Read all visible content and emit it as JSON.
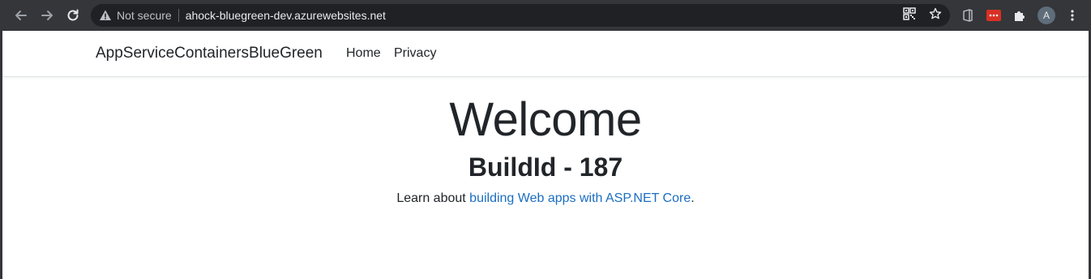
{
  "browser": {
    "address_security": "Not secure",
    "url": "ahock-bluegreen-dev.azurewebsites.net",
    "profile_initial": "A"
  },
  "navbar": {
    "brand": "AppServiceContainersBlueGreen",
    "links": [
      "Home",
      "Privacy"
    ]
  },
  "main": {
    "heading": "Welcome",
    "build_id": "BuildId - 187",
    "learn_prefix": "Learn about ",
    "learn_link": "building Web apps with ASP.NET Core",
    "learn_suffix": "."
  },
  "colors": {
    "chrome_bg": "#35363a",
    "omnibox_bg": "#202124",
    "link": "#1b6ec2",
    "text": "#212529"
  }
}
